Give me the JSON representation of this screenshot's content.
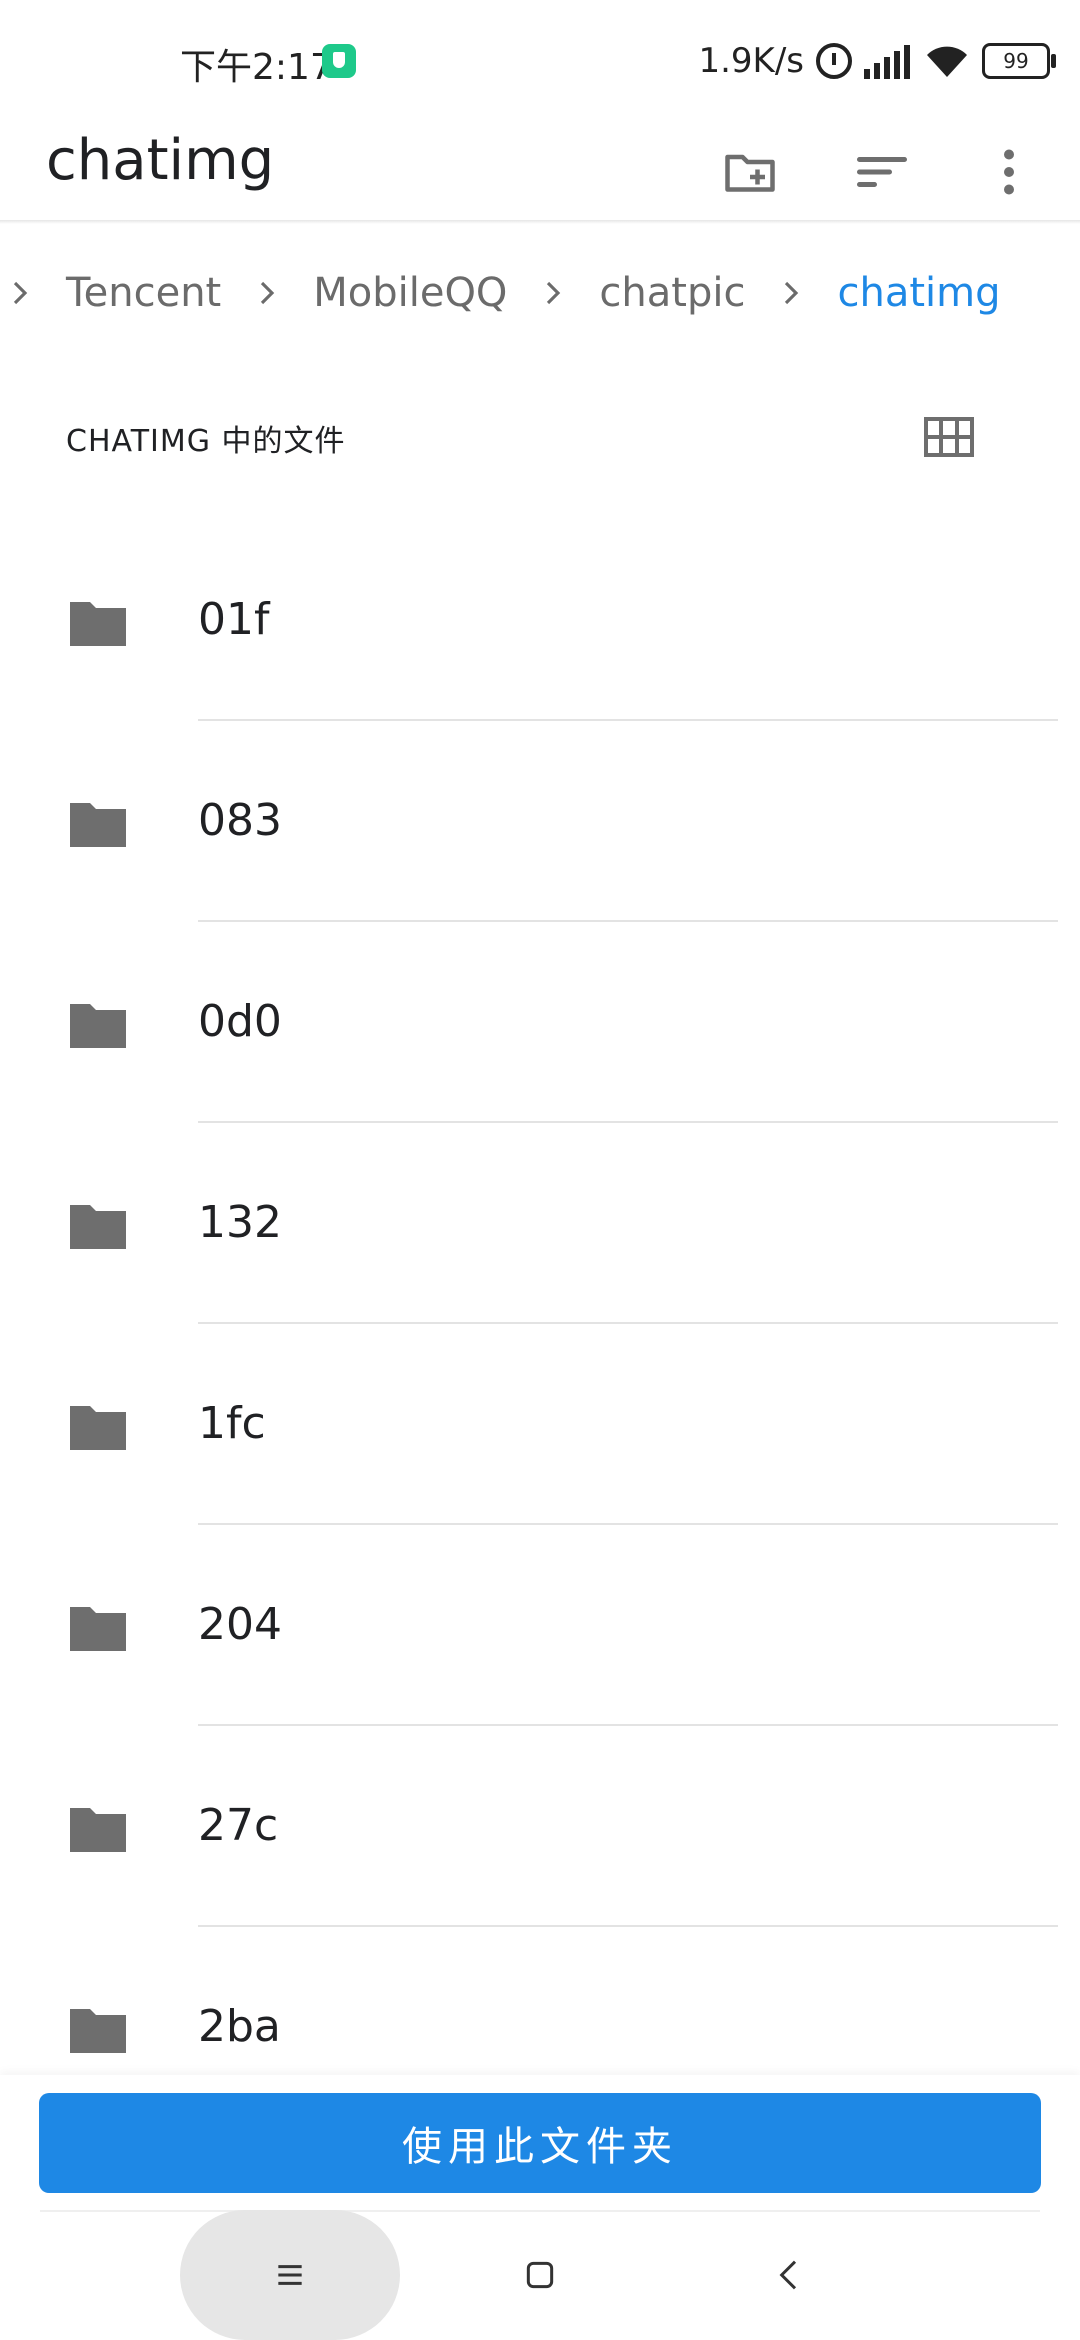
{
  "status_bar": {
    "time": "下午2:17",
    "net_speed": "1.9K/s",
    "battery": "99"
  },
  "app_bar": {
    "title": "chatimg",
    "actions": [
      "new-folder-icon",
      "sort-icon",
      "more-vert-icon"
    ]
  },
  "breadcrumb": {
    "items": [
      {
        "label": "Tencent",
        "active": false
      },
      {
        "label": "MobileQQ",
        "active": false
      },
      {
        "label": "chatpic",
        "active": false
      },
      {
        "label": "chatimg",
        "active": true
      }
    ]
  },
  "section": {
    "header": "CHATIMG 中的文件"
  },
  "folders": [
    {
      "name": "01f"
    },
    {
      "name": "083"
    },
    {
      "name": "0d0"
    },
    {
      "name": "132"
    },
    {
      "name": "1fc"
    },
    {
      "name": "204"
    },
    {
      "name": "27c"
    },
    {
      "name": "2ba"
    }
  ],
  "actions": {
    "use_folder_label": "使用此文件夹"
  },
  "colors": {
    "accent": "#1e88e5",
    "icon_gray": "#6e6e6e"
  }
}
